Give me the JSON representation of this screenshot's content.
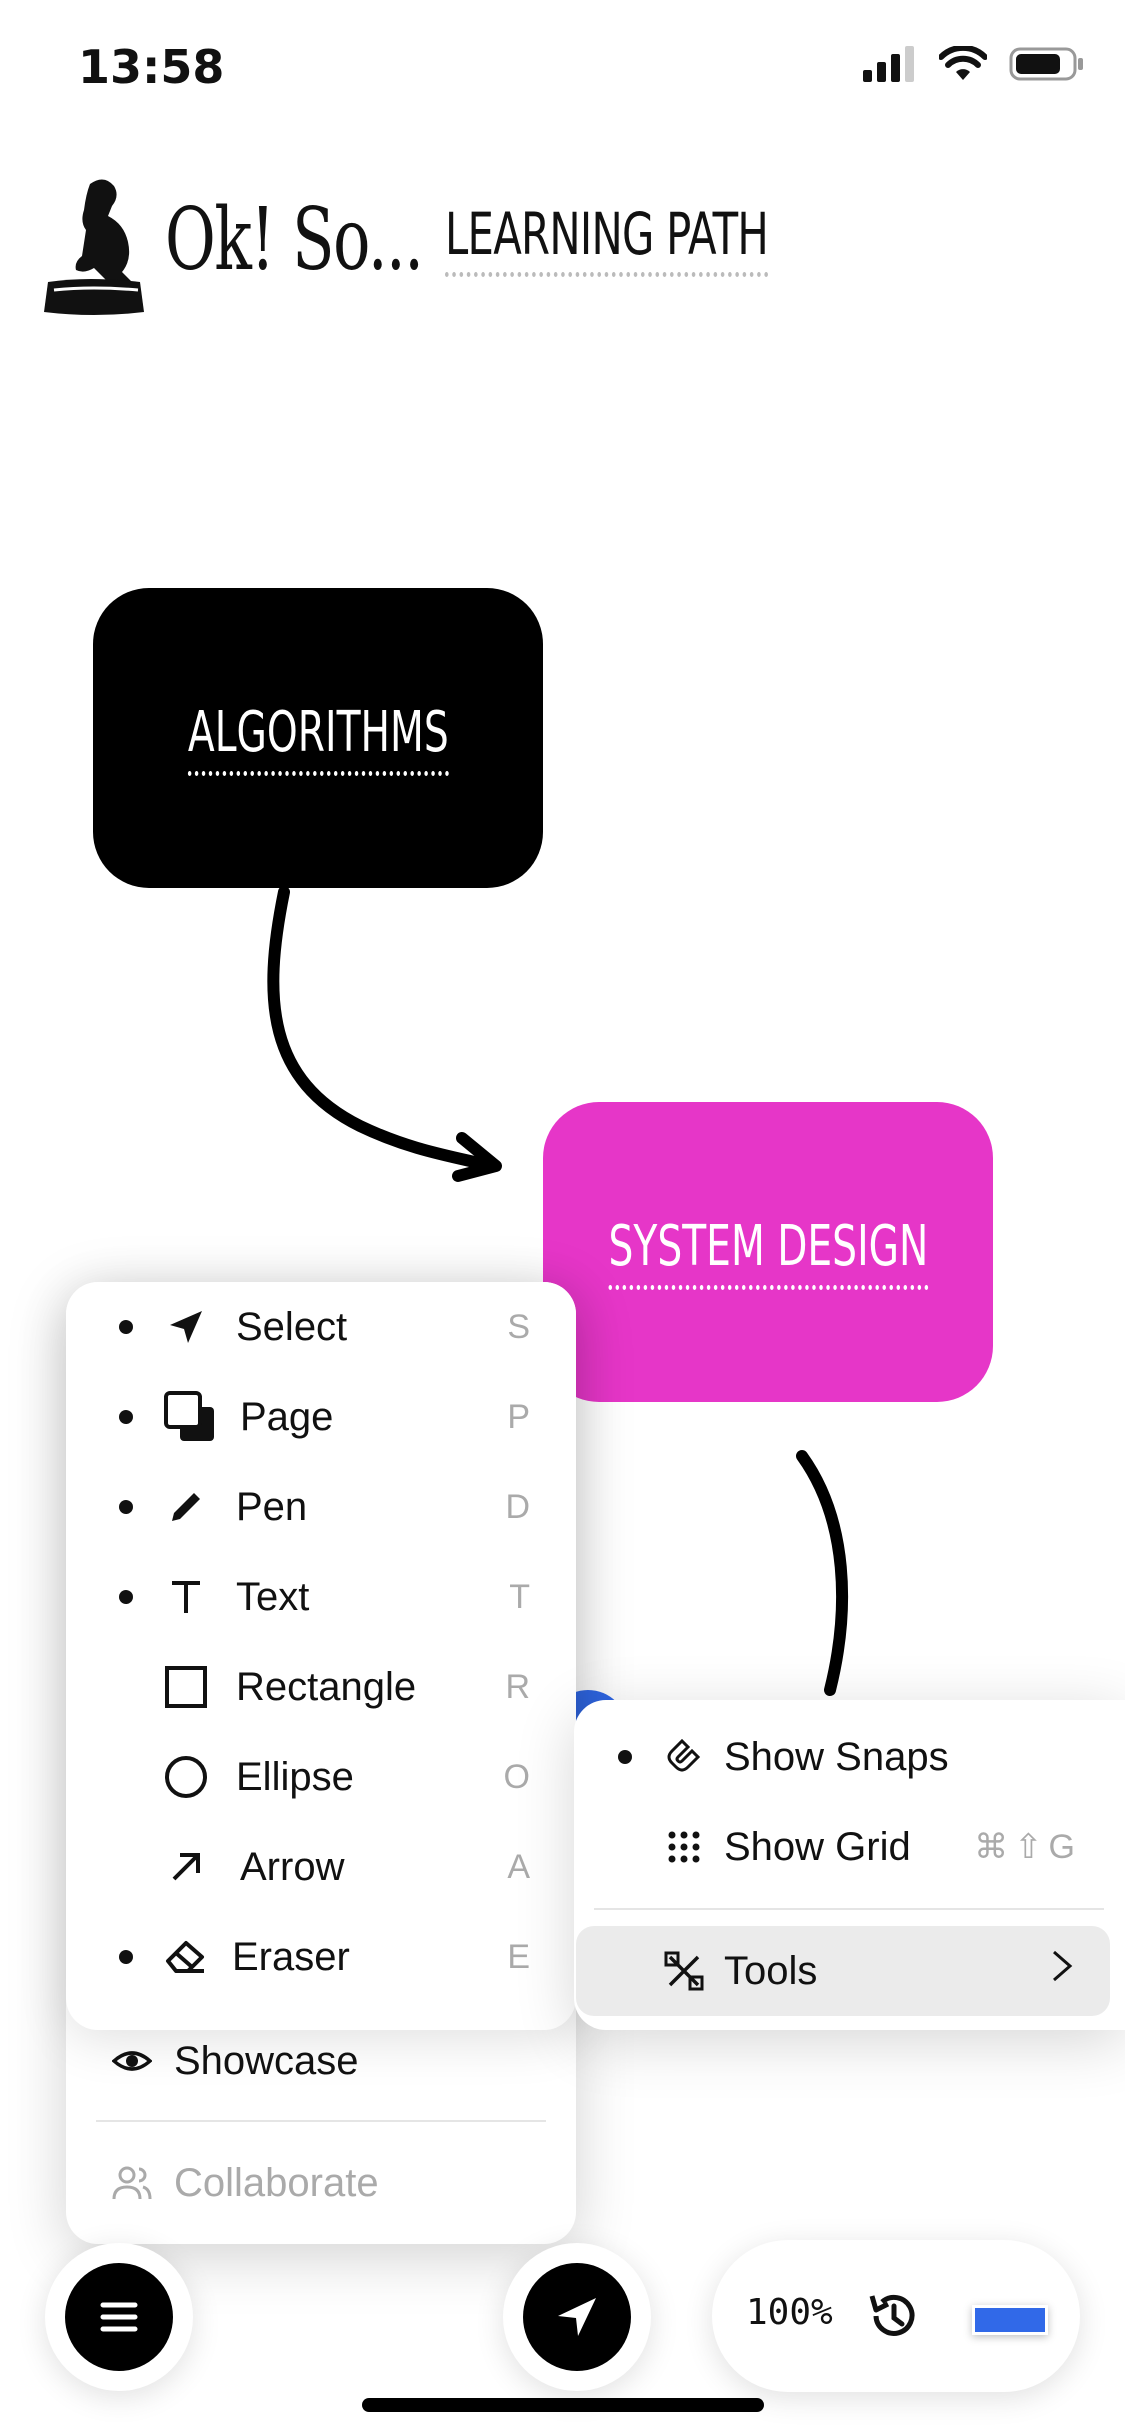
{
  "status": {
    "time": "13:58"
  },
  "header": {
    "brand": "Ok! So...",
    "path_link": "LEARNING PATH"
  },
  "canvas": {
    "nodes": [
      {
        "label": "ALGORITHMS",
        "color": "#000000"
      },
      {
        "label": "SYSTEM DESIGN",
        "color": "#e636c8"
      }
    ]
  },
  "tools_menu": {
    "items": [
      {
        "label": "Select",
        "shortcut": "S",
        "icon": "select-arrow-icon"
      },
      {
        "label": "Page",
        "shortcut": "P",
        "icon": "page-icon"
      },
      {
        "label": "Pen",
        "shortcut": "D",
        "icon": "pen-icon"
      },
      {
        "label": "Text",
        "shortcut": "T",
        "icon": "text-icon"
      },
      {
        "label": "Rectangle",
        "shortcut": "R",
        "icon": "rectangle-icon"
      },
      {
        "label": "Ellipse",
        "shortcut": "O",
        "icon": "ellipse-icon"
      },
      {
        "label": "Arrow",
        "shortcut": "A",
        "icon": "arrow-icon"
      },
      {
        "label": "Eraser",
        "shortcut": "E",
        "icon": "eraser-icon"
      }
    ]
  },
  "main_menu": {
    "showcase": "Showcase",
    "collaborate": "Collaborate"
  },
  "submenu": {
    "show_snaps": "Show Snaps",
    "show_grid": "Show Grid",
    "show_grid_shortcut": "⌘⇧G",
    "tools": "Tools"
  },
  "toolbar": {
    "zoom": "100%",
    "color": "#3169e8"
  }
}
